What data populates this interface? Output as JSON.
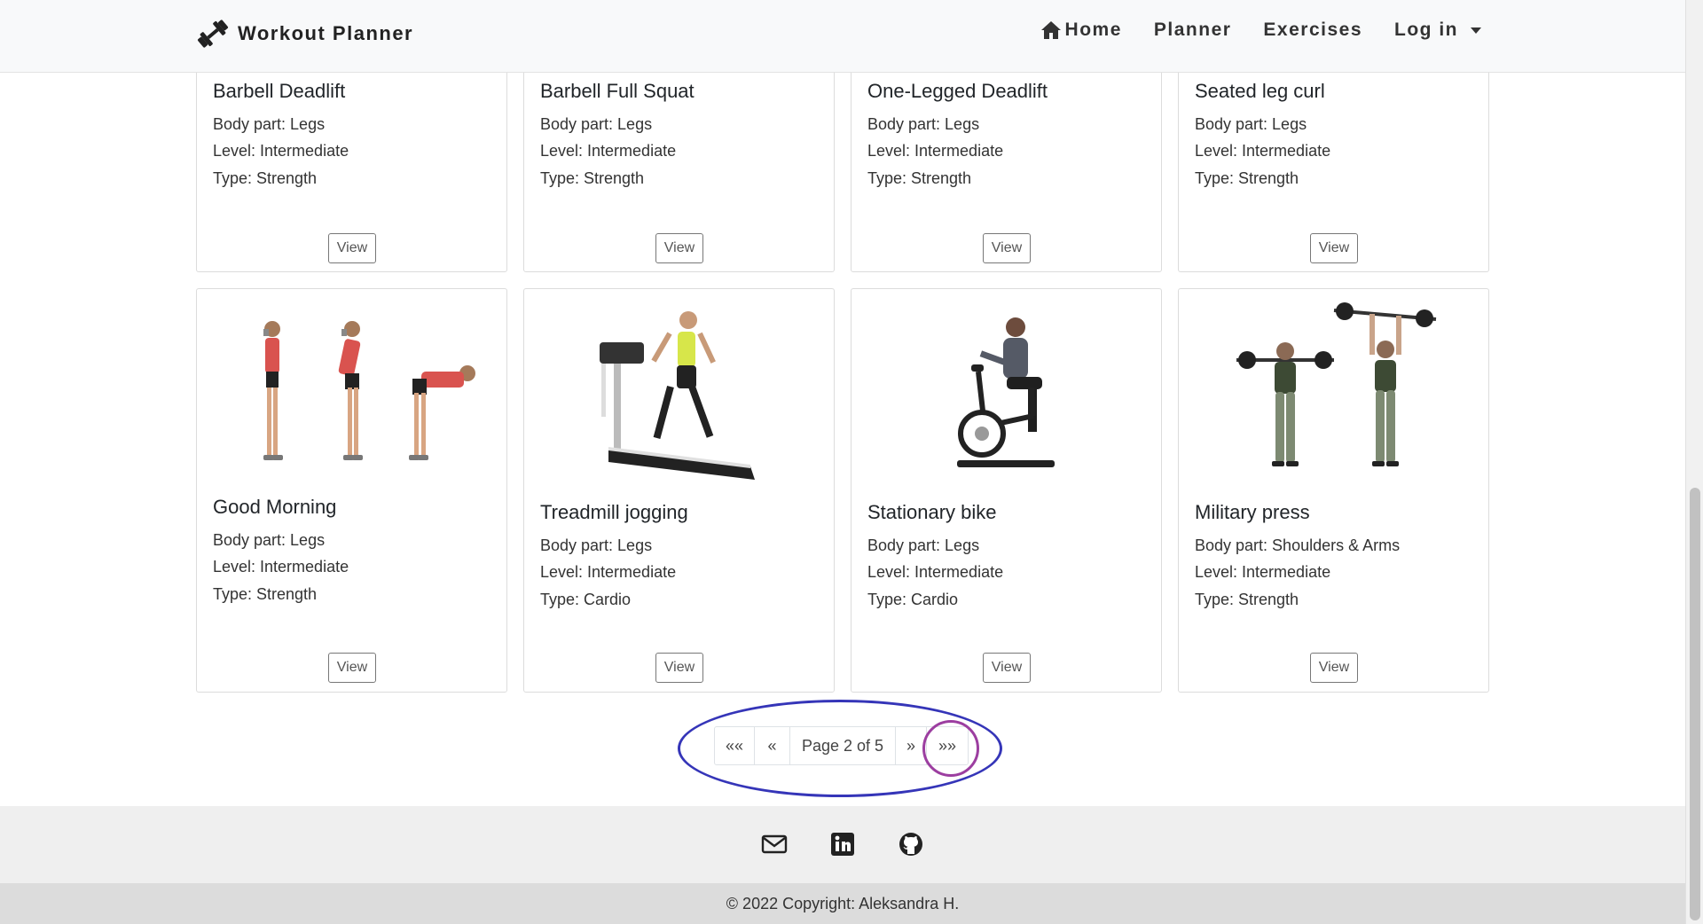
{
  "navbar": {
    "brand": "Workout Planner",
    "links": [
      "Home",
      "Planner",
      "Exercises",
      "Log in"
    ]
  },
  "labels": {
    "body_part_prefix": "Body part: ",
    "level_prefix": "Level: ",
    "type_prefix": "Type: ",
    "view_button": "View"
  },
  "cards": [
    {
      "title": "Barbell Deadlift",
      "body_part": "Body part: Legs",
      "level": "Level: Intermediate",
      "type": "Type: Strength",
      "view": "View"
    },
    {
      "title": "Barbell Full Squat",
      "body_part": "Body part: Legs",
      "level": "Level: Intermediate",
      "type": "Type: Strength",
      "view": "View"
    },
    {
      "title": "One-Legged Deadlift",
      "body_part": "Body part: Legs",
      "level": "Level: Intermediate",
      "type": "Type: Strength",
      "view": "View"
    },
    {
      "title": "Seated leg curl",
      "body_part": "Body part: Legs",
      "level": "Level: Intermediate",
      "type": "Type: Strength",
      "view": "View"
    },
    {
      "title": "Good Morning",
      "body_part": "Body part: Legs",
      "level": "Level: Intermediate",
      "type": "Type: Strength",
      "view": "View",
      "image": "good-morning-exercise-illustration"
    },
    {
      "title": "Treadmill jogging",
      "body_part": "Body part: Legs",
      "level": "Level: Intermediate",
      "type": "Type: Cardio",
      "view": "View",
      "image": "treadmill-runner-photo"
    },
    {
      "title": "Stationary bike",
      "body_part": "Body part: Legs",
      "level": "Level: Intermediate",
      "type": "Type: Cardio",
      "view": "View",
      "image": "stationary-bike-rider-photo"
    },
    {
      "title": "Military press",
      "body_part": "Body part: Shoulders & Arms",
      "level": "Level: Intermediate",
      "type": "Type: Strength",
      "view": "View",
      "image": "military-press-photo"
    }
  ],
  "pagination": {
    "first": "««",
    "prev": "«",
    "current": "Page 2 of 5",
    "next": "»",
    "last": "»»",
    "current_page": 2,
    "total_pages": 5
  },
  "footer": {
    "icons": [
      "mail-icon",
      "linkedin-icon",
      "github-icon"
    ],
    "copyright": "© 2022 Copyright: Aleksandra H."
  },
  "colors": {
    "navbar_bg": "#f8f9fa",
    "annotation_outer": "#3535b8",
    "annotation_inner": "#9c3ea0"
  }
}
